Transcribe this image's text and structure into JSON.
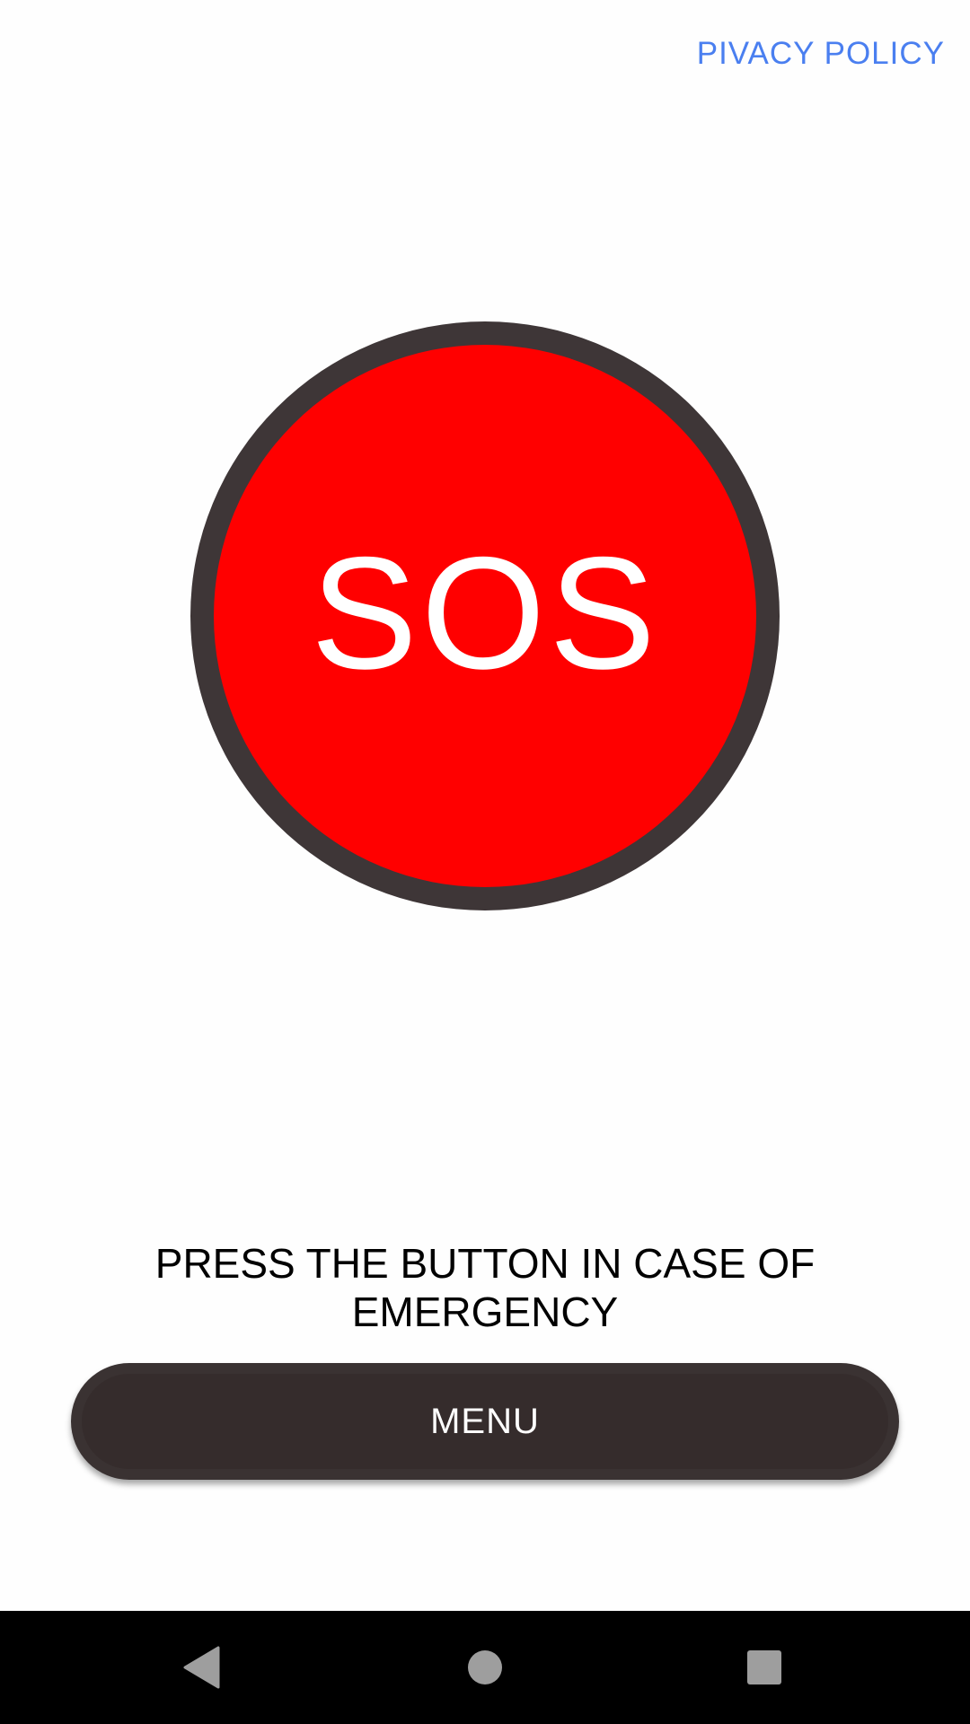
{
  "header": {
    "privacy_link": "PIVACY POLICY"
  },
  "sos": {
    "label": "SOS"
  },
  "instructions": {
    "text": "PRESS THE BUTTON IN CASE OF EMERGENCY"
  },
  "menu": {
    "label": "MENU"
  },
  "navbar": {
    "back_icon": "back-triangle-icon",
    "home_icon": "home-circle-icon",
    "recents_icon": "recents-square-icon"
  },
  "colors": {
    "link": "#4a7ff0",
    "sos_ring": "#3e3637",
    "sos_fill": "#ff0000",
    "menu_bg": "#3a3232",
    "navbar_bg": "#000000",
    "nav_icon": "#9e9e9e"
  }
}
